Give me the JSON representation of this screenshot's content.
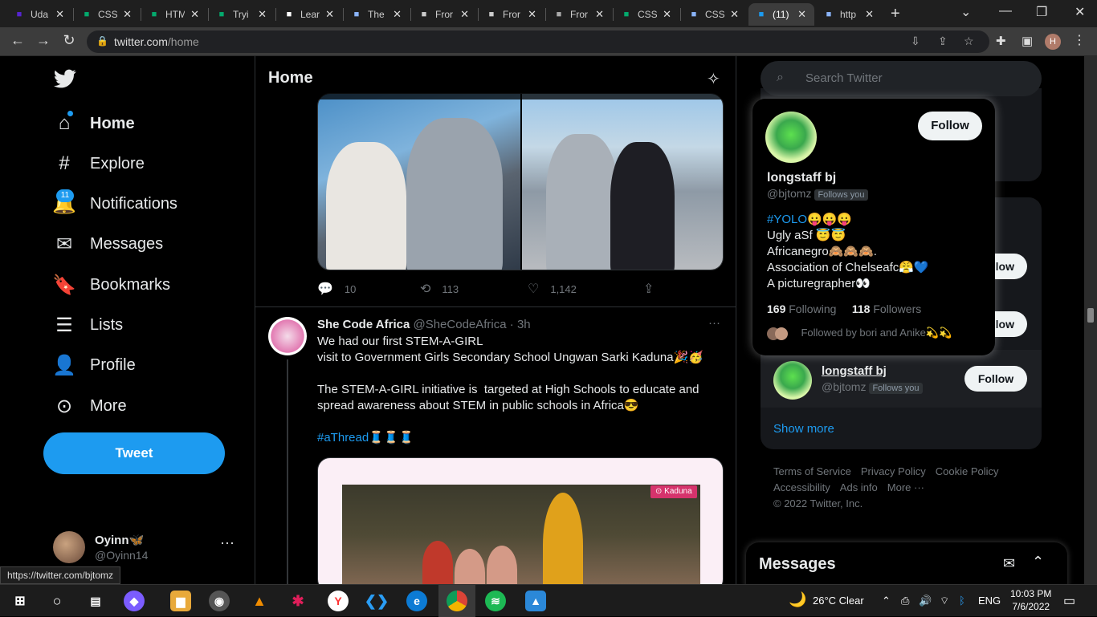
{
  "browser": {
    "tabs": [
      {
        "label": "Uda",
        "icon": "udemy-icon",
        "color": "#5624d0"
      },
      {
        "label": "CSS",
        "icon": "w3schools-icon",
        "color": "#04aa6d"
      },
      {
        "label": "HTM",
        "icon": "w3schools-icon",
        "color": "#04aa6d"
      },
      {
        "label": "Tryi",
        "icon": "w3schools-icon",
        "color": "#04aa6d"
      },
      {
        "label": "Lear",
        "icon": "medium-icon",
        "color": "#ffffff"
      },
      {
        "label": "The",
        "icon": "link-icon",
        "color": "#8ab4f8"
      },
      {
        "label": "Fror",
        "icon": "page-icon",
        "color": "#cccccc"
      },
      {
        "label": "Fror",
        "icon": "page-icon",
        "color": "#cccccc"
      },
      {
        "label": "Fror",
        "icon": "globe-icon",
        "color": "#aaaaaa"
      },
      {
        "label": "CSS",
        "icon": "w3schools-icon",
        "color": "#04aa6d"
      },
      {
        "label": "CSS",
        "icon": "a-icon",
        "color": "#8ab4f8"
      },
      {
        "label": "(11)",
        "icon": "twitter-icon",
        "color": "#1d9bf0",
        "active": true
      },
      {
        "label": "http",
        "icon": "a-icon",
        "color": "#8ab4f8"
      }
    ],
    "address": {
      "domain": "twitter.com",
      "path": "/home"
    },
    "profile_initial": "H",
    "status_url": "https://twitter.com/bjtomz"
  },
  "sidebar": {
    "nav": [
      {
        "label": "Home",
        "icon": "home-icon"
      },
      {
        "label": "Explore",
        "icon": "hashtag-icon"
      },
      {
        "label": "Notifications",
        "icon": "bell-icon"
      },
      {
        "label": "Messages",
        "icon": "envelope-icon"
      },
      {
        "label": "Bookmarks",
        "icon": "bookmark-icon"
      },
      {
        "label": "Lists",
        "icon": "list-icon"
      },
      {
        "label": "Profile",
        "icon": "person-icon"
      },
      {
        "label": "More",
        "icon": "more-circle-icon"
      }
    ],
    "notification_count": "11",
    "tweet_button": "Tweet",
    "account": {
      "name": "Oyinn🦋",
      "handle": "@Oyinn14"
    }
  },
  "main": {
    "title": "Home",
    "tweet1_actions": {
      "replies": "10",
      "retweets": "113",
      "likes": "1,142"
    },
    "tweet2": {
      "name": "She Code Africa",
      "handle": "@SheCodeAfrica",
      "time": "· 3h",
      "line1": "We had our first STEM-A-GIRL",
      "line2": "visit to Government Girls Secondary School Ungwan Sarki Kaduna🎉🥳",
      "para2": "The STEM-A-GIRL initiative is  targeted at High Schools to educate and spread awareness about STEM in public schools in Africa😎",
      "hashtag": "#aThread",
      "hashtag_emoji": "🧵🧵🧵",
      "location_label": "Kaduna"
    }
  },
  "right": {
    "search_placeholder": "Search Twitter",
    "follow_label": "Follow",
    "follow_partial": "llow",
    "who_to_follow": {
      "name": "longstaff bj",
      "handle": "@bjtomz",
      "follows_you": "Follows you"
    },
    "show_more": "Show more",
    "footer_line1": [
      "Terms of Service",
      "Privacy Policy",
      "Cookie Policy"
    ],
    "footer_line2": [
      "Accessibility",
      "Ads info",
      "More ···"
    ],
    "copyright": "© 2022 Twitter, Inc.",
    "messages_title": "Messages"
  },
  "hovercard": {
    "name": "longstaff bj",
    "handle": "@bjtomz",
    "follows_you": "Follows you",
    "follow": "Follow",
    "bio_tag": "#YOLO",
    "bio_tag_emoji": "😛😛😛",
    "bio_rest": "Ugly aSf 😇😇\nAfricanegro🙈🙈🙈.\nAssociation of Chelseafc😤💙\nA picturegrapher👀",
    "following_count": "169",
    "following_label": "Following",
    "followers_count": "118",
    "followers_label": "Followers",
    "followed_by": "Followed by bori and Anike💫💫"
  },
  "taskbar": {
    "weather": "26°C  Clear",
    "language": "ENG",
    "time": "10:03 PM",
    "date": "7/6/2022"
  }
}
